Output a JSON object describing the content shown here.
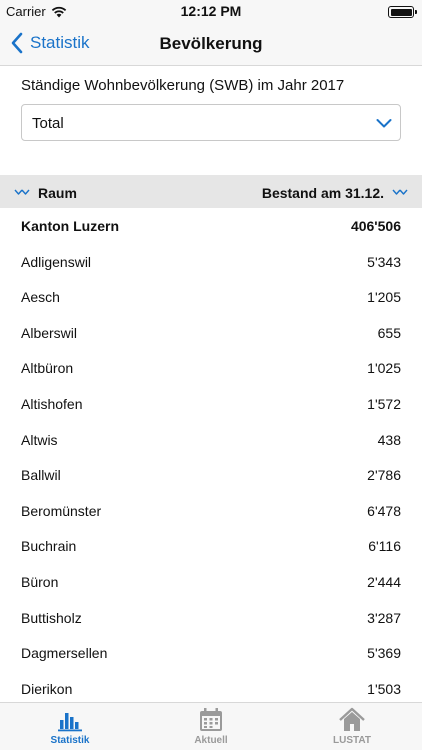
{
  "status_bar": {
    "carrier": "Carrier",
    "time": "12:12 PM"
  },
  "nav": {
    "back_label": "Statistik",
    "title": "Bevölkerung"
  },
  "filter": {
    "subtitle": "Ständige Wohnbevölkerung (SWB) im Jahr 2017",
    "selected": "Total"
  },
  "table": {
    "col_name": "Raum",
    "col_value": "Bestand am 31.12.",
    "total": {
      "name": "Kanton Luzern",
      "value": "406'506"
    },
    "rows": [
      {
        "name": "Adligenswil",
        "value": "5'343"
      },
      {
        "name": "Aesch",
        "value": "1'205"
      },
      {
        "name": "Alberswil",
        "value": "655"
      },
      {
        "name": "Altbüron",
        "value": "1'025"
      },
      {
        "name": "Altishofen",
        "value": "1'572"
      },
      {
        "name": "Altwis",
        "value": "438"
      },
      {
        "name": "Ballwil",
        "value": "2'786"
      },
      {
        "name": "Beromünster",
        "value": "6'478"
      },
      {
        "name": "Buchrain",
        "value": "6'116"
      },
      {
        "name": "Büron",
        "value": "2'444"
      },
      {
        "name": "Buttisholz",
        "value": "3'287"
      },
      {
        "name": "Dagmersellen",
        "value": "5'369"
      },
      {
        "name": "Dierikon",
        "value": "1'503"
      }
    ]
  },
  "tabs": [
    {
      "label": "Statistik",
      "icon": "bar-chart-icon",
      "active": true
    },
    {
      "label": "Aktuell",
      "icon": "calendar-icon",
      "active": false
    },
    {
      "label": "LUSTAT",
      "icon": "house-icon",
      "active": false
    }
  ],
  "colors": {
    "accent": "#1a73c9",
    "inactive": "#9a9a9a",
    "header_bg": "#e6e6e6"
  }
}
